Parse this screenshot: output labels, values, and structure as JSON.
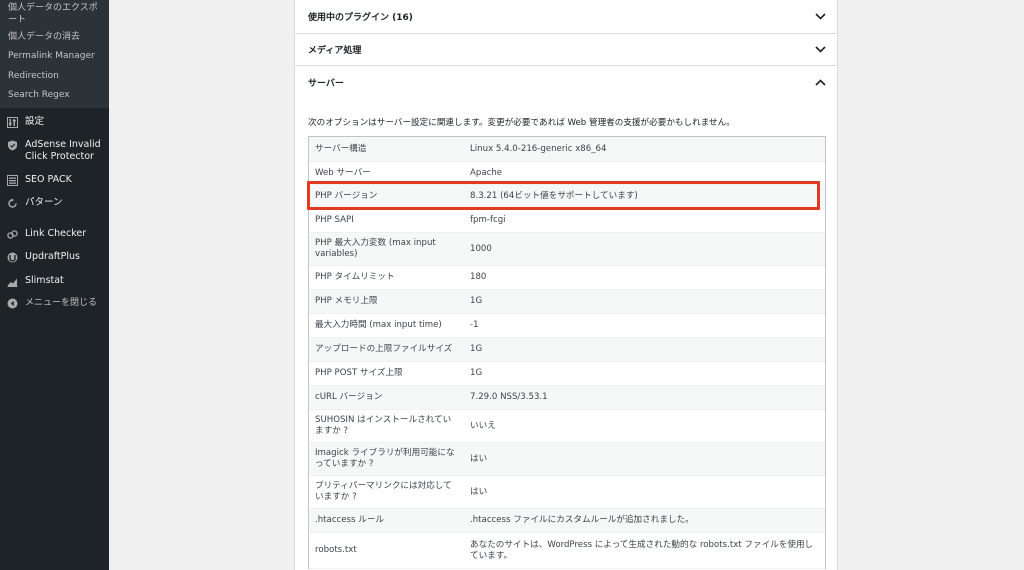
{
  "sidebar": {
    "submenu": [
      {
        "label": "個人データのエクスポート",
        "wrap": true
      },
      {
        "label": "個人データの消去",
        "wrap": false
      },
      {
        "label": "Permalink Manager",
        "wrap": false
      },
      {
        "label": "Redirection",
        "wrap": false
      },
      {
        "label": "Search Regex",
        "wrap": false
      }
    ],
    "menu": [
      {
        "label": "設定",
        "icon": "settings-icon"
      },
      {
        "label": "AdSense Invalid Click Protector",
        "icon": "shield-icon"
      },
      {
        "label": "SEO PACK",
        "icon": "list-icon"
      },
      {
        "label": "パターン",
        "icon": "rotate-icon"
      },
      {
        "label": "Link Checker",
        "icon": "link-icon"
      },
      {
        "label": "UpdraftPlus",
        "icon": "updraft-icon"
      },
      {
        "label": "Slimstat",
        "icon": "chart-icon"
      },
      {
        "label": "メニューを閉じる",
        "icon": "collapse-icon"
      }
    ]
  },
  "accordion": {
    "plugins_title": "使用中のプラグイン (16)",
    "media_title": "メディア処理",
    "server_title": "サーバー"
  },
  "server": {
    "description": "次のオプションはサーバー設定に関連します。変更が必要であれば Web 管理者の支援が必要かもしれません。",
    "rows": [
      {
        "key": "サーバー構造",
        "value": "Linux 5.4.0-216-generic x86_64"
      },
      {
        "key": "Web サーバー",
        "value": "Apache"
      },
      {
        "key": "PHP バージョン",
        "value": "8.3.21 (64ビット値をサポートしています)"
      },
      {
        "key": "PHP SAPI",
        "value": "fpm-fcgi"
      },
      {
        "key": "PHP 最大入力変数 (max input variables)",
        "value": "1000"
      },
      {
        "key": "PHP タイムリミット",
        "value": "180"
      },
      {
        "key": "PHP メモリ上限",
        "value": "1G"
      },
      {
        "key": "最大入力時間 (max input time)",
        "value": "-1"
      },
      {
        "key": "アップロードの上限ファイルサイズ",
        "value": "1G"
      },
      {
        "key": "PHP POST サイズ上限",
        "value": "1G"
      },
      {
        "key": "cURL バージョン",
        "value": "7.29.0 NSS/3.53.1"
      },
      {
        "key": "SUHOSIN はインストールされていますか ?",
        "value": "いいえ"
      },
      {
        "key": "Imagick ライブラリが利用可能になっていますか ?",
        "value": "はい"
      },
      {
        "key": "プリティパーマリンクには対応していますか ?",
        "value": "はい"
      },
      {
        "key": ".htaccess ルール",
        "value": ".htaccess ファイルにカスタムルールが追加されました。"
      },
      {
        "key": "robots.txt",
        "value": "あなたのサイトは、WordPress によって生成された動的な robots.txt ファイルを使用しています。"
      }
    ]
  },
  "colors": {
    "sidebar_bg": "#1d2327",
    "submenu_bg": "#2c3338",
    "highlight": "#e03a22"
  }
}
